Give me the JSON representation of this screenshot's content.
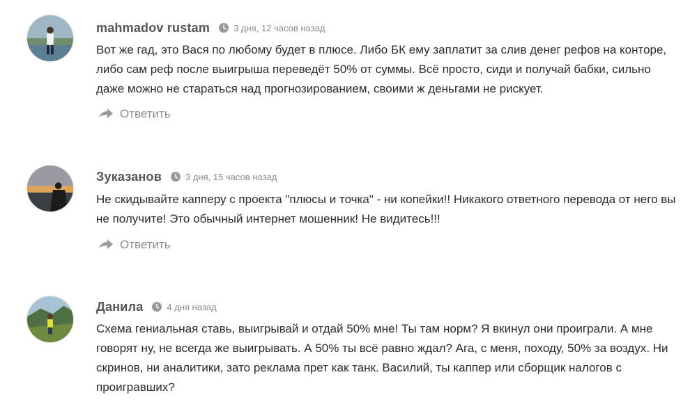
{
  "comments": [
    {
      "author": "mahmadov rustam",
      "time": "3 дня, 12 часов назад",
      "text": "Вот же гад, это Вася по любому будет в плюсе. Либо БК ему заплатит за слив денег рефов на конторе, либо сам реф после выигрыша переведёт 50% от суммы. Всё просто, сиди и получай бабки, сильно даже можно не стараться над прогнозированием, своими ж деньгами не рискует.",
      "reply_label": "Ответить"
    },
    {
      "author": "Зуказанов",
      "time": "3 дня, 15 часов назад",
      "text": "Не скидывайте капперу с проекта \"плюсы и точка\" - ни копейки!! Никакого ответного перевода от него вы не получите! Это обычный интернет мошенник! Не видитесь!!!",
      "reply_label": "Ответить"
    },
    {
      "author": "Данила",
      "time": "4 дня назад",
      "text": "Схема гениальная ставь, выигрывай и отдай 50% мне! Ты там норм? Я вкинул они проиграли. А мне говорят ну, не всегда же выигрывать. А 50% ты всё равно ждал? Ага, с меня, походу, 50% за воздух. Ни скринов, ни аналитики, зато реклама прет как танк. Василий, ты каппер или сборщик налогов с проигравших?",
      "reply_label": ""
    }
  ],
  "icons": {
    "time": "clock-icon",
    "reply": "reply-arrow-icon"
  },
  "colors": {
    "author": "#555555",
    "meta": "#8a8a8a",
    "text": "#2b2b2b",
    "reply": "#8c8c8c",
    "icon": "#9a9a9a"
  }
}
